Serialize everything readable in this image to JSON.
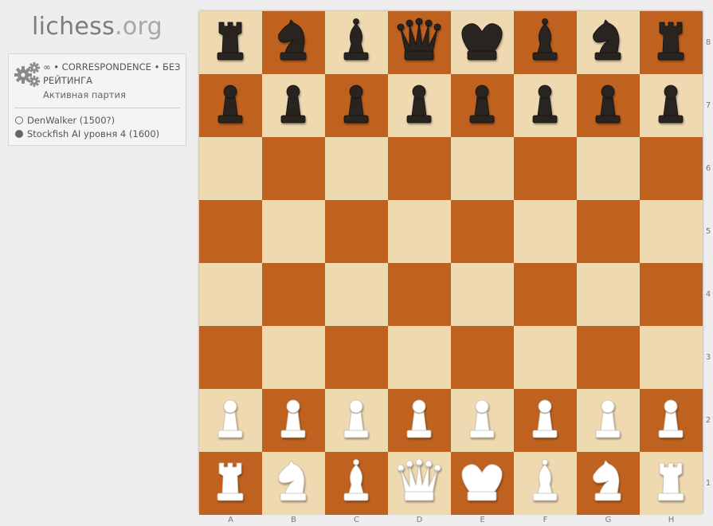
{
  "header": {
    "logo_main": "lichess",
    "logo_tld": ".org"
  },
  "game": {
    "icon": "gears-icon",
    "setup": "∞ • CORRESPONDENCE • БЕЗ РЕЙТИНГА",
    "status": "Активная партия",
    "players": [
      {
        "name": "DenWalker (1500?)",
        "color": "white"
      },
      {
        "name": "Stockfish AI уровня 4 (1600)",
        "color": "black"
      }
    ]
  },
  "board": {
    "colors": {
      "light": "#efd9b0",
      "dark": "#c0621f",
      "black_piece": "#2a2420",
      "white_piece": "#ffffff"
    },
    "ranks": [
      "8",
      "7",
      "6",
      "5",
      "4",
      "3",
      "2",
      "1"
    ],
    "files": [
      "A",
      "B",
      "C",
      "D",
      "E",
      "F",
      "G",
      "H"
    ],
    "position": [
      [
        "bR",
        "bN",
        "bB",
        "bQ",
        "bK",
        "bB",
        "bN",
        "bR"
      ],
      [
        "bP",
        "bP",
        "bP",
        "bP",
        "bP",
        "bP",
        "bP",
        "bP"
      ],
      [
        "",
        "",
        "",
        "",
        "",
        "",
        "",
        ""
      ],
      [
        "",
        "",
        "",
        "",
        "",
        "",
        "",
        ""
      ],
      [
        "",
        "",
        "",
        "",
        "",
        "",
        "",
        ""
      ],
      [
        "",
        "",
        "",
        "",
        "",
        "",
        "",
        ""
      ],
      [
        "wP",
        "wP",
        "wP",
        "wP",
        "wP",
        "wP",
        "wP",
        "wP"
      ],
      [
        "wR",
        "wN",
        "wB",
        "wQ",
        "wK",
        "wB",
        "wN",
        "wR"
      ]
    ]
  }
}
